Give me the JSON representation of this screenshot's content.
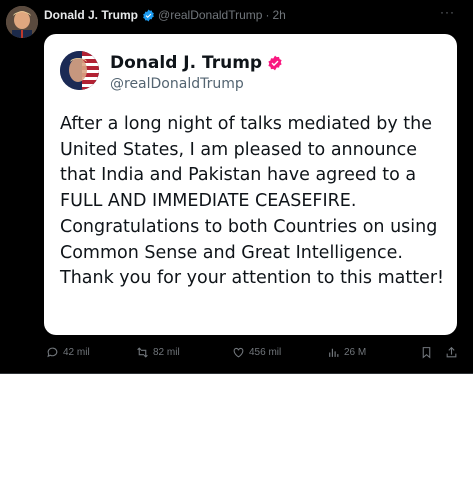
{
  "post": {
    "author_name": "Donald J. Trump",
    "handle": "@realDonaldTrump",
    "separator": "·",
    "time": "2h",
    "more": "···"
  },
  "quoted_card": {
    "author_name": "Donald J. Trump",
    "handle": "@realDonaldTrump",
    "text": "After a long night of talks mediated by the United States, I am pleased to announce that India and Pakistan have agreed to a FULL AND IMMEDIATE CEASEFIRE. Congratulations to both Countries on using Common Sense and Great Intelligence. Thank you for your attention to this matter!"
  },
  "actions": {
    "replies": "42 mil",
    "reposts": "82 mil",
    "likes": "456 mil",
    "views": "26 M"
  },
  "colors": {
    "background": "#000000",
    "verified_blue": "#1d9bf0",
    "verified_pink": "#f91880",
    "muted": "#71767b"
  },
  "icons": [
    "verified-icon",
    "more-icon",
    "reply-icon",
    "retweet-icon",
    "like-icon",
    "views-icon",
    "bookmark-icon",
    "share-icon"
  ]
}
